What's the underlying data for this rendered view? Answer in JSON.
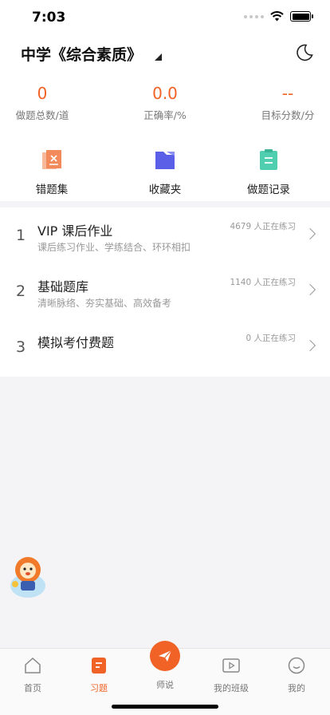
{
  "status": {
    "time": "7:03"
  },
  "header": {
    "subject": "中学《综合素质》"
  },
  "stats": [
    {
      "value": "0",
      "label": "做题总数/道"
    },
    {
      "value": "0.0",
      "label": "正确率/%"
    },
    {
      "value": "--",
      "label": "目标分数/分"
    }
  ],
  "tools": [
    {
      "label": "错题集",
      "icon": "wrong-questions-icon"
    },
    {
      "label": "收藏夹",
      "icon": "favorites-folder-icon"
    },
    {
      "label": "做题记录",
      "icon": "records-clipboard-icon"
    }
  ],
  "list": [
    {
      "num": "1",
      "title": "VIP 课后作业",
      "subtitle": "课后练习作业、学练结合、环环相扣",
      "count": "4679 人正在练习"
    },
    {
      "num": "2",
      "title": "基础题库",
      "subtitle": "清晰脉络、夯实基础、高效备考",
      "count": "1140 人正在练习"
    },
    {
      "num": "3",
      "title": "模拟考付费题",
      "subtitle": "",
      "count": "0 人正在练习"
    }
  ],
  "tabs": [
    {
      "label": "首页"
    },
    {
      "label": "习题"
    },
    {
      "label": "师说"
    },
    {
      "label": "我的班级"
    },
    {
      "label": "我的"
    }
  ],
  "colors": {
    "accent": "#f06225",
    "tool_orange": "#f28a5b",
    "tool_blue": "#5b5fe8",
    "tool_green": "#4fcfb0"
  }
}
